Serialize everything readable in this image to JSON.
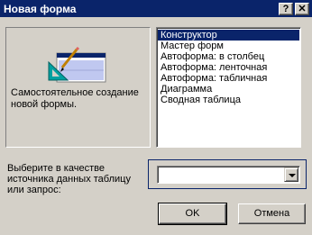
{
  "window": {
    "title": "Новая форма",
    "help_label": "?",
    "close_label": "✕"
  },
  "preview": {
    "description": "Самостоятельное создание новой формы."
  },
  "wizard_list": {
    "selected_index": 0,
    "items": [
      "Конструктор",
      "Мастер форм",
      "Автоформа: в столбец",
      "Автоформа: ленточная",
      "Автоформа: табличная",
      "Диаграмма",
      "Сводная таблица"
    ]
  },
  "source": {
    "label": "Выберите в качестве источника данных таблицу или запрос:",
    "value": ""
  },
  "buttons": {
    "ok": "OK",
    "cancel": "Отмена"
  },
  "colors": {
    "titlebar": "#0a246a",
    "face": "#d4d0c8",
    "selection": "#0a246a"
  }
}
